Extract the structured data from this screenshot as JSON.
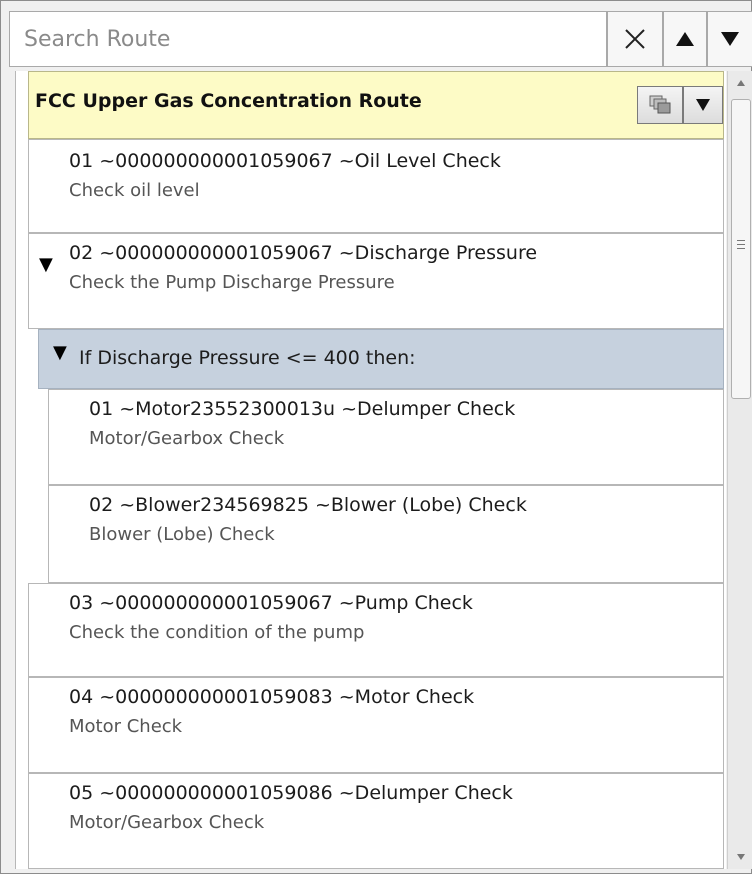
{
  "search": {
    "placeholder": "Search Route",
    "value": ""
  },
  "toolbar": {
    "clear": "×",
    "up": "▲",
    "down": "▼"
  },
  "route": {
    "title": "FCC Upper Gas Concentration Route",
    "items": [
      {
        "line1": "01 ~000000000001059067 ~Oil Level Check",
        "line2": "Check oil level"
      },
      {
        "line1": "02 ~000000000001059067 ~Discharge Pressure",
        "line2": "Check the Pump Discharge Pressure"
      },
      {
        "line1": "03 ~000000000001059067 ~Pump Check",
        "line2": "Check the condition of the pump"
      },
      {
        "line1": "04 ~000000000001059083 ~Motor Check",
        "line2": "Motor Check"
      },
      {
        "line1": "05 ~000000000001059086 ~Delumper Check",
        "line2": "Motor/Gearbox Check"
      }
    ],
    "condition": {
      "label": "If Discharge Pressure <= 400 then:",
      "items": [
        {
          "line1": "01 ~Motor23552300013u ~Delumper Check",
          "line2": "Motor/Gearbox Check"
        },
        {
          "line1": "02 ~Blower234569825 ~Blower (Lobe) Check",
          "line2": "Blower (Lobe) Check"
        }
      ]
    }
  },
  "colors": {
    "header_bg": "#fdfbc6",
    "condition_bg": "#c6d1de"
  }
}
